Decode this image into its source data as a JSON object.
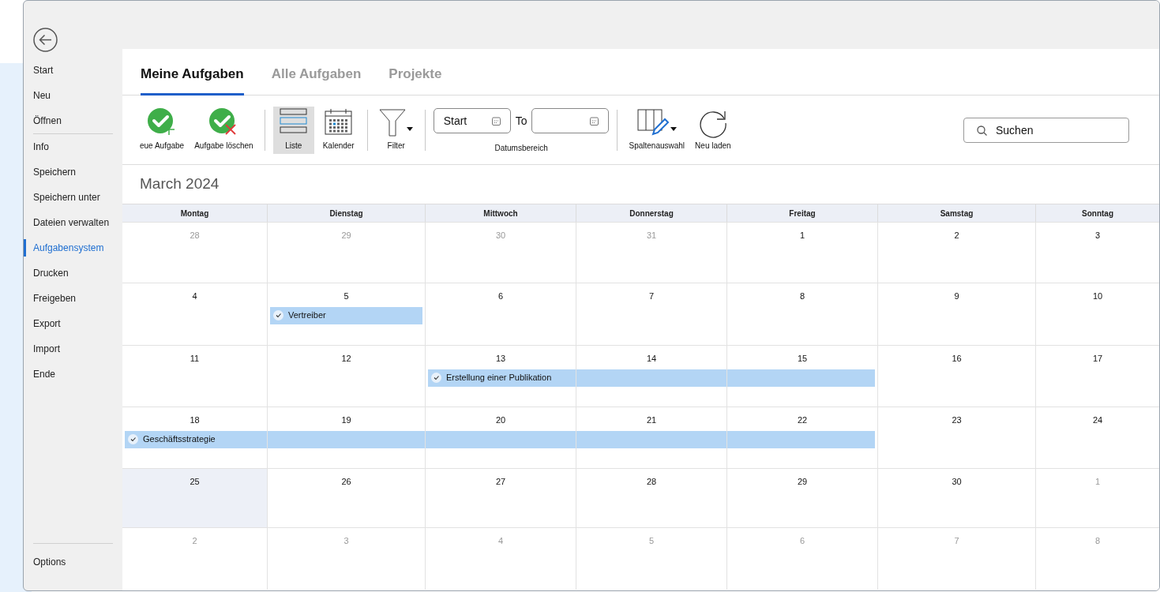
{
  "sidebar": {
    "groups": [
      {
        "items": [
          {
            "label": "Start",
            "selected": false
          },
          {
            "label": "Neu",
            "selected": false
          },
          {
            "label": "Öffnen",
            "selected": false
          }
        ]
      },
      {
        "items": [
          {
            "label": "Info",
            "selected": false
          },
          {
            "label": "Speichern",
            "selected": false
          },
          {
            "label": "Speichern unter",
            "selected": false
          },
          {
            "label": "Dateien verwalten",
            "selected": false
          },
          {
            "label": "Aufgabensystem",
            "selected": true
          },
          {
            "label": "Drucken",
            "selected": false
          },
          {
            "label": "Freigeben",
            "selected": false
          },
          {
            "label": "Export",
            "selected": false
          },
          {
            "label": "Import",
            "selected": false
          },
          {
            "label": "Ende",
            "selected": false
          }
        ]
      }
    ],
    "footer": [
      {
        "label": "Options",
        "selected": false
      }
    ]
  },
  "tabs": [
    {
      "label": "Meine Aufgaben",
      "selected": true
    },
    {
      "label": "Alle Aufgaben",
      "selected": false
    },
    {
      "label": "Projekte",
      "selected": false
    }
  ],
  "toolbar": {
    "groups": [
      {
        "items": [
          {
            "kind": "add",
            "label": "eue Aufgabe",
            "selected": false
          },
          {
            "kind": "delete",
            "label": "Aufgabe löschen",
            "selected": false
          }
        ]
      },
      {
        "items": [
          {
            "kind": "list",
            "label": "Liste",
            "selected": true
          },
          {
            "kind": "calendar",
            "label": "Kalender",
            "selected": false
          }
        ]
      },
      {
        "items": [
          {
            "kind": "filter",
            "label": "Filter",
            "selected": false
          }
        ]
      },
      {
        "items": [
          {
            "kind": "daterange",
            "label": "Datumsbereich",
            "start_value": "Start",
            "to_label": "To"
          }
        ]
      },
      {
        "items": [
          {
            "kind": "columns",
            "label": "Spaltenauswahl",
            "selected": false
          },
          {
            "kind": "reload",
            "label": "Neu laden",
            "selected": false
          }
        ]
      }
    ],
    "search": {
      "placeholder": "Suchen"
    }
  },
  "calendar": {
    "title": "March 2024",
    "columns": [
      "Montag",
      "Dienstag",
      "Mittwoch",
      "Donnerstag",
      "Freitag",
      "Samstag",
      "Sonntag"
    ],
    "weeks": [
      {
        "days": [
          {
            "label": "28",
            "in_month": false,
            "selected": false
          },
          {
            "label": "29",
            "in_month": false,
            "selected": false
          },
          {
            "label": "30",
            "in_month": false,
            "selected": false
          },
          {
            "label": "31",
            "in_month": false,
            "selected": false
          },
          {
            "label": "1",
            "in_month": true,
            "selected": false
          },
          {
            "label": "2",
            "in_month": true,
            "selected": false
          },
          {
            "label": "3",
            "in_month": true,
            "selected": false
          }
        ]
      },
      {
        "task": {
          "title": "Vertreiber"
        },
        "days": [
          {
            "label": "4",
            "in_month": true,
            "selected": false,
            "task_bar": false
          },
          {
            "label": "5",
            "in_month": true,
            "selected": false,
            "task_bar": true
          },
          {
            "label": "6",
            "in_month": true,
            "selected": false,
            "task_bar": false
          },
          {
            "label": "7",
            "in_month": true,
            "selected": false,
            "task_bar": false
          },
          {
            "label": "8",
            "in_month": true,
            "selected": false,
            "task_bar": false
          },
          {
            "label": "9",
            "in_month": true,
            "selected": false,
            "task_bar": false
          },
          {
            "label": "10",
            "in_month": true,
            "selected": false,
            "task_bar": false
          }
        ]
      },
      {
        "task": {
          "title": "Erstellung einer Publikation"
        },
        "days": [
          {
            "label": "11",
            "in_month": true,
            "selected": false,
            "task_bar": false
          },
          {
            "label": "12",
            "in_month": true,
            "selected": false,
            "task_bar": false
          },
          {
            "label": "13",
            "in_month": true,
            "selected": false,
            "task_bar": true
          },
          {
            "label": "14",
            "in_month": true,
            "selected": false,
            "task_bar": true
          },
          {
            "label": "15",
            "in_month": true,
            "selected": false,
            "task_bar": true
          },
          {
            "label": "16",
            "in_month": true,
            "selected": false,
            "task_bar": false
          },
          {
            "label": "17",
            "in_month": true,
            "selected": false,
            "task_bar": false
          }
        ]
      },
      {
        "task": {
          "title": "Geschäftsstrategie"
        },
        "days": [
          {
            "label": "18",
            "in_month": true,
            "selected": false,
            "task_bar": true
          },
          {
            "label": "19",
            "in_month": true,
            "selected": false,
            "task_bar": true
          },
          {
            "label": "20",
            "in_month": true,
            "selected": false,
            "task_bar": true
          },
          {
            "label": "21",
            "in_month": true,
            "selected": false,
            "task_bar": true
          },
          {
            "label": "22",
            "in_month": true,
            "selected": false,
            "task_bar": true
          },
          {
            "label": "23",
            "in_month": true,
            "selected": false,
            "task_bar": false
          },
          {
            "label": "24",
            "in_month": true,
            "selected": false,
            "task_bar": false
          }
        ]
      },
      {
        "days": [
          {
            "label": "25",
            "in_month": true,
            "selected": true
          },
          {
            "label": "26",
            "in_month": true,
            "selected": false
          },
          {
            "label": "27",
            "in_month": true,
            "selected": false
          },
          {
            "label": "28",
            "in_month": true,
            "selected": false
          },
          {
            "label": "29",
            "in_month": true,
            "selected": false
          },
          {
            "label": "30",
            "in_month": true,
            "selected": false
          },
          {
            "label": "1",
            "in_month": false,
            "selected": false
          }
        ]
      },
      {
        "days": [
          {
            "label": "2",
            "in_month": false,
            "selected": false
          },
          {
            "label": "3",
            "in_month": false,
            "selected": false
          },
          {
            "label": "4",
            "in_month": false,
            "selected": false
          },
          {
            "label": "5",
            "in_month": false,
            "selected": false
          },
          {
            "label": "6",
            "in_month": false,
            "selected": false
          },
          {
            "label": "7",
            "in_month": false,
            "selected": false
          },
          {
            "label": "8",
            "in_month": false,
            "selected": false
          }
        ]
      }
    ]
  }
}
